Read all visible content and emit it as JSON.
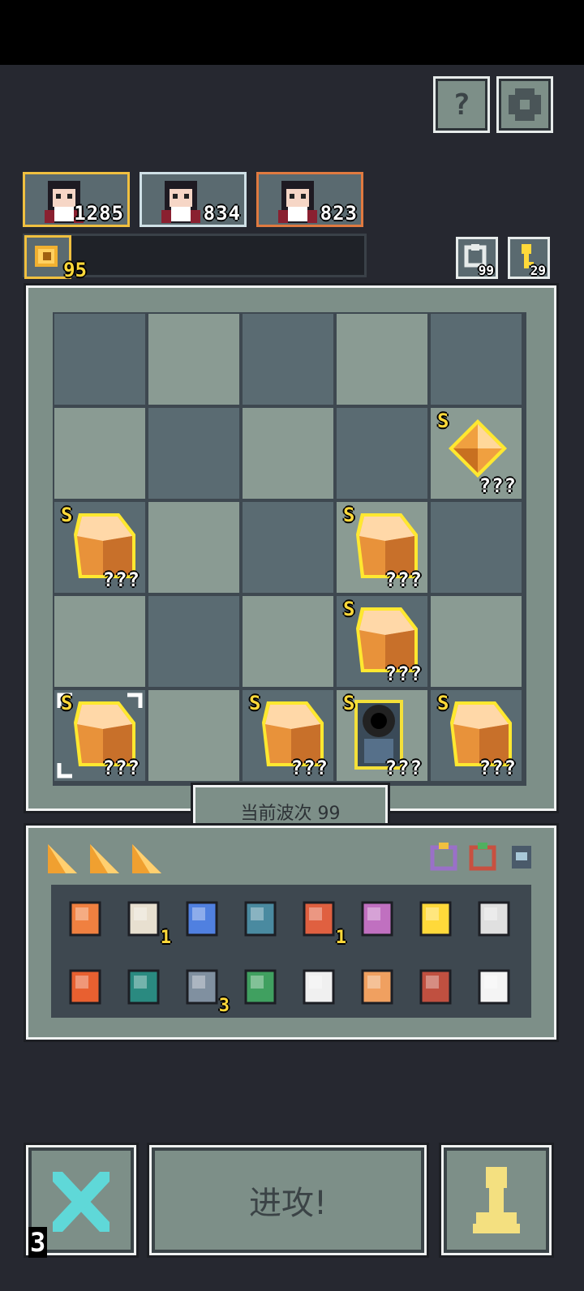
{
  "header": {
    "help_label": "?",
    "settings_icon": "gear-icon"
  },
  "heroes": [
    {
      "value": "1285",
      "frame_color": "#f0c040"
    },
    {
      "value": "834",
      "frame_color": "#cfe0e6"
    },
    {
      "value": "823",
      "frame_color": "#e07a40"
    }
  ],
  "coin": {
    "value": "95"
  },
  "resources": {
    "reroll": {
      "value": "99"
    },
    "key": {
      "value": "29"
    }
  },
  "board": {
    "pieces": [
      {
        "row": 1,
        "col": 4,
        "grade": "S",
        "label": "???",
        "type": "gem"
      },
      {
        "row": 2,
        "col": 0,
        "grade": "S",
        "label": "???",
        "type": "box"
      },
      {
        "row": 2,
        "col": 3,
        "grade": "S",
        "label": "???",
        "type": "box"
      },
      {
        "row": 3,
        "col": 3,
        "grade": "S",
        "label": "???",
        "type": "box"
      },
      {
        "row": 4,
        "col": 0,
        "grade": "S",
        "label": "???",
        "type": "box",
        "selected": true
      },
      {
        "row": 4,
        "col": 2,
        "grade": "S",
        "label": "???",
        "type": "box"
      },
      {
        "row": 4,
        "col": 3,
        "grade": "S",
        "label": "???",
        "type": "hero"
      },
      {
        "row": 4,
        "col": 4,
        "grade": "S",
        "label": "???",
        "type": "box"
      }
    ]
  },
  "wave": {
    "label": "当前波次 99"
  },
  "inventory": {
    "tabs": [
      "tab-1",
      "tab-2",
      "tab-3"
    ],
    "accessories": [
      "ring-purple",
      "ring-red",
      "helmet"
    ],
    "items": [
      {
        "name": "scroll-icon",
        "count": ""
      },
      {
        "name": "eye-amulet-icon",
        "count": "1"
      },
      {
        "name": "crown-gem-icon",
        "count": ""
      },
      {
        "name": "mirror-icon",
        "count": ""
      },
      {
        "name": "horn-icon",
        "count": "1"
      },
      {
        "name": "book-icon",
        "count": ""
      },
      {
        "name": "fox-charm-icon",
        "count": ""
      },
      {
        "name": "dagger-small-icon",
        "count": ""
      },
      {
        "name": "fox-tail-icon",
        "count": ""
      },
      {
        "name": "table-icon",
        "count": ""
      },
      {
        "name": "sword-icon",
        "count": "3"
      },
      {
        "name": "green-pot-icon",
        "count": ""
      },
      {
        "name": "potion-bottle-icon",
        "count": ""
      },
      {
        "name": "rabbit-icon",
        "count": ""
      },
      {
        "name": "plant-fox-icon",
        "count": ""
      },
      {
        "name": "vase-icon",
        "count": ""
      }
    ]
  },
  "bottom": {
    "cancel_count": "3",
    "attack_label": "进攻!",
    "pawn_icon": "pawn-icon"
  }
}
